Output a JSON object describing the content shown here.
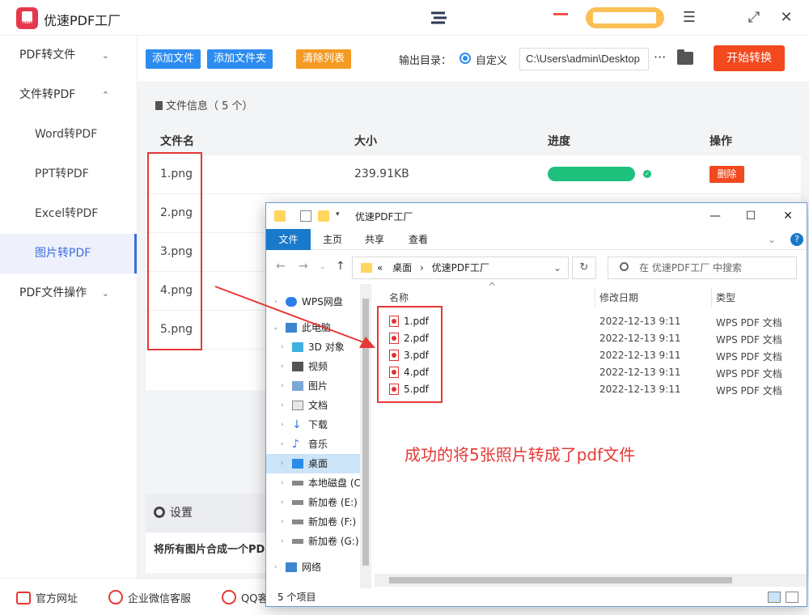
{
  "app": {
    "title": "优速PDF工厂"
  },
  "sidebar": {
    "items": [
      {
        "label": "PDF转文件",
        "chevron": "⌄"
      },
      {
        "label": "文件转PDF",
        "chevron": "⌃"
      },
      {
        "label": "Word转PDF"
      },
      {
        "label": "PPT转PDF"
      },
      {
        "label": "Excel转PDF"
      },
      {
        "label": "图片转PDF"
      },
      {
        "label": "PDF文件操作",
        "chevron": "⌄"
      }
    ]
  },
  "toolbar": {
    "add_file": "添加文件",
    "add_folder": "添加文件夹",
    "clear_list": "清除列表",
    "output_label": "输出目录：",
    "custom_label": "自定义",
    "output_path": "C:\\Users\\admin\\Desktop",
    "more": "···",
    "start": "开始转换"
  },
  "file_info": {
    "title": "文件信息（ 5 个）",
    "columns": [
      "文件名",
      "大小",
      "进度",
      "操作"
    ],
    "rows": [
      {
        "name": "1.png",
        "size": "239.91KB",
        "progress": 1.0,
        "action": "删除"
      },
      {
        "name": "2.png"
      },
      {
        "name": "3.png"
      },
      {
        "name": "4.png"
      },
      {
        "name": "5.png"
      }
    ]
  },
  "settings": {
    "title": "设置",
    "option": "将所有图片合成一个PDF"
  },
  "footer": {
    "website": "官方网址",
    "wechat": "企业微信客服",
    "qq": "QQ客服"
  },
  "explorer": {
    "title": "优速PDF工厂",
    "ribbon": [
      "文件",
      "主页",
      "共享",
      "查看"
    ],
    "breadcrumb": [
      "«",
      "桌面",
      "›",
      "优速PDF工厂"
    ],
    "search_placeholder": "在 优速PDF工厂 中搜索",
    "nav": [
      {
        "label": "WPS网盘",
        "icon": "cloud-icon"
      },
      {
        "label": "此电脑",
        "icon": "computer-icon"
      },
      {
        "label": "3D 对象",
        "icon": "cube-icon"
      },
      {
        "label": "视频",
        "icon": "video-icon"
      },
      {
        "label": "图片",
        "icon": "picture-icon"
      },
      {
        "label": "文档",
        "icon": "document-icon"
      },
      {
        "label": "下载",
        "icon": "download-icon"
      },
      {
        "label": "音乐",
        "icon": "music-icon"
      },
      {
        "label": "桌面",
        "icon": "desktop-icon"
      },
      {
        "label": "本地磁盘 (C:)",
        "icon": "drive-icon"
      },
      {
        "label": "新加卷 (E:)",
        "icon": "drive-icon"
      },
      {
        "label": "新加卷 (F:)",
        "icon": "drive-icon"
      },
      {
        "label": "新加卷 (G:)",
        "icon": "drive-icon"
      },
      {
        "label": "网络",
        "icon": "network-icon"
      }
    ],
    "columns": [
      "名称",
      "修改日期",
      "类型"
    ],
    "files": [
      {
        "name": "1.pdf",
        "date": "2022-12-13 9:11",
        "type": "WPS PDF 文档"
      },
      {
        "name": "2.pdf",
        "date": "2022-12-13 9:11",
        "type": "WPS PDF 文档"
      },
      {
        "name": "3.pdf",
        "date": "2022-12-13 9:11",
        "type": "WPS PDF 文档"
      },
      {
        "name": "4.pdf",
        "date": "2022-12-13 9:11",
        "type": "WPS PDF 文档"
      },
      {
        "name": "5.pdf",
        "date": "2022-12-13 9:11",
        "type": "WPS PDF 文档"
      }
    ],
    "status": "5 个项目"
  },
  "annotation": {
    "caption": "成功的将5张照片转成了pdf文件",
    "color": "#e53935"
  },
  "colors": {
    "accent_blue": "#2d8cf0",
    "accent_orange": "#f59a23",
    "start_red": "#f2491e",
    "progress_green": "#1ec07c"
  }
}
